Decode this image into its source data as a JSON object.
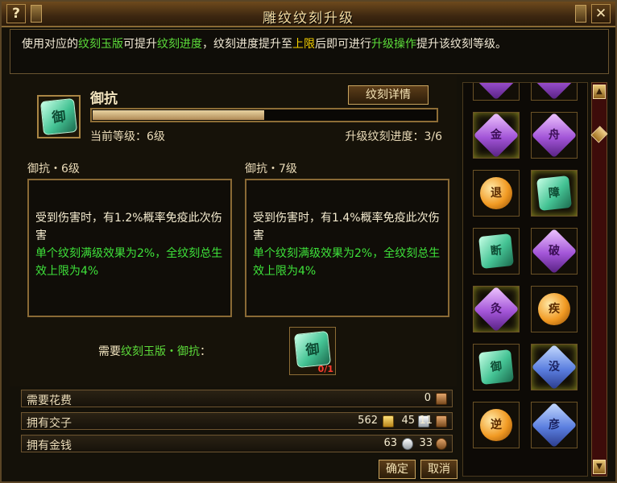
{
  "window": {
    "title": "雕纹纹刻升级",
    "help_label": "?",
    "close_label": "✕"
  },
  "info": {
    "p1": "使用对应的",
    "hl1": "纹刻玉版",
    "p2": "可提升",
    "hl2": "纹刻进度",
    "p3": "，纹刻进度提升至",
    "hl3": "上限",
    "p4": "后即可进行",
    "hl4": "升级操作",
    "p5": "提升该纹刻等级。"
  },
  "engraving": {
    "icon_glyph": "御",
    "name": "御抗",
    "detail_button": "纹刻详情",
    "current_level": "当前等级：6级",
    "progress_text": "升级纹刻进度：3/6",
    "progress_fraction": 0.5
  },
  "current_effect": {
    "title": "御抗・6级",
    "text": "受到伤害时，有1.2%概率免疫此次伤害",
    "sub": "单个纹刻满级效果为2%，全纹刻总生效上限为4%"
  },
  "next_effect": {
    "title": "御抗・7级",
    "text": "受到伤害时，有1.4%概率免疫此次伤害",
    "sub": "单个纹刻满级效果为2%，全纹刻总生效上限为4%"
  },
  "requirement": {
    "label_prefix": "需要",
    "label_hl": "纹刻玉版・御抗",
    "label_suffix": "：",
    "item_glyph": "御",
    "count": "0/1"
  },
  "costs": {
    "need_label": "需要花费",
    "need_value": "0",
    "have_jiaozi_label": "拥有交子",
    "jiaozi_gold": "562",
    "jiaozi_silver": "45",
    "jiaozi_bronze": "11",
    "have_money_label": "拥有金钱",
    "money_silver": "63",
    "money_bronze": "33"
  },
  "buttons": {
    "confirm": "确定",
    "cancel": "取消"
  },
  "gem_panel": {
    "items": [
      {
        "glyph": "",
        "color": "purple"
      },
      {
        "glyph": "",
        "color": "purple"
      },
      {
        "glyph": "金",
        "color": "purple"
      },
      {
        "glyph": "舟",
        "color": "purple"
      },
      {
        "glyph": "退",
        "color": "orange"
      },
      {
        "glyph": "障",
        "color": "green"
      },
      {
        "glyph": "断",
        "color": "green"
      },
      {
        "glyph": "破",
        "color": "purple"
      },
      {
        "glyph": "灸",
        "color": "purple"
      },
      {
        "glyph": "疾",
        "color": "orange"
      },
      {
        "glyph": "御",
        "color": "green"
      },
      {
        "glyph": "没",
        "color": "blue"
      },
      {
        "glyph": "逆",
        "color": "orange"
      },
      {
        "glyph": "彦",
        "color": "blue"
      }
    ],
    "scroll_up": "▲",
    "scroll_down": "▼"
  }
}
